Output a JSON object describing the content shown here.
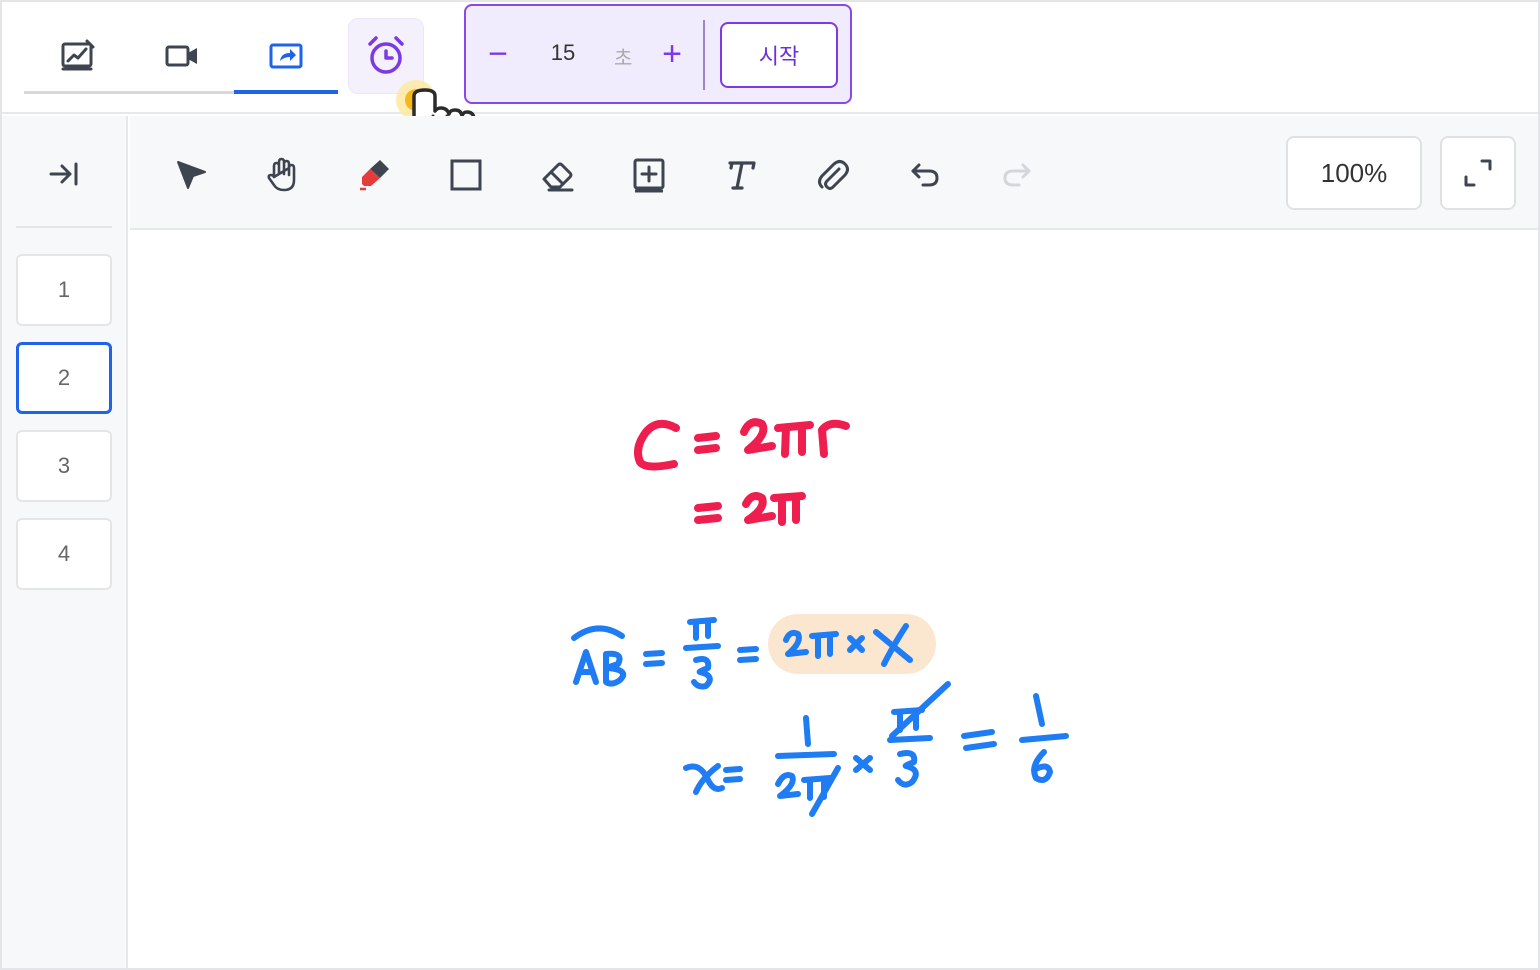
{
  "mode_tabs": [
    {
      "icon": "whiteboard-chart-icon",
      "active": false
    },
    {
      "icon": "video-camera-icon",
      "active": false
    },
    {
      "icon": "share-screen-icon",
      "active": true
    }
  ],
  "timer": {
    "icon": "alarm-clock-icon",
    "decrement_label": "−",
    "value": "15",
    "unit": "초",
    "increment_label": "+",
    "start_label": "시작",
    "accent_color": "#7b3ae6"
  },
  "sidebar": {
    "collapse_icon": "collapse-right-icon",
    "pages": [
      {
        "label": "1",
        "active": false
      },
      {
        "label": "2",
        "active": true
      },
      {
        "label": "3",
        "active": false
      },
      {
        "label": "4",
        "active": false
      }
    ]
  },
  "toolbar": {
    "tools": [
      "select-arrow-icon",
      "hand-pan-icon",
      "pen-marker-icon",
      "rectangle-icon",
      "eraser-icon",
      "add-page-icon",
      "text-icon",
      "attach-clip-icon",
      "undo-icon",
      "redo-icon"
    ],
    "zoom_label": "100%",
    "fullscreen_icon": "expand-icon"
  },
  "canvas": {
    "handwriting": {
      "red_line_1": "C=2πr",
      "red_line_2": "=2π",
      "blue_line_1": "AB = π/3 = 2π × x",
      "blue_line_2": "x = 1/2π × π/3 = 1/6"
    },
    "colors": {
      "red_ink": "#ee1e4e",
      "blue_ink": "#1f7cf2",
      "highlight": "#fbe6cf",
      "accent_blue": "#1e63e8"
    }
  }
}
